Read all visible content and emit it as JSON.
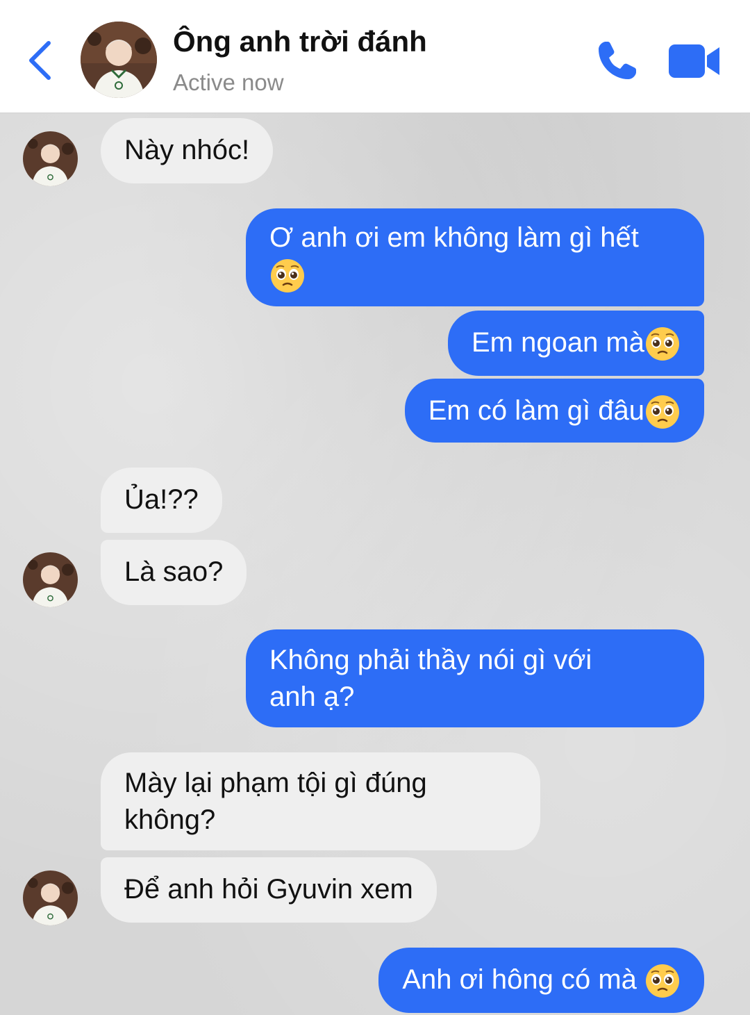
{
  "header": {
    "contact_name": "Ông anh trời đánh",
    "status": "Active now",
    "icons": {
      "back": "chevron-left-icon",
      "call": "phone-icon",
      "video": "video-camera-icon"
    },
    "accent_color": "#2d6df6"
  },
  "messages": [
    {
      "side": "in",
      "text": "Này nhóc!"
    },
    {
      "side": "out",
      "line1": "Ơ anh ơi em không làm gì hết",
      "emoji": "pleading-face-icon"
    },
    {
      "side": "out",
      "text": "Em ngoan mà",
      "emoji": "pleading-face-icon"
    },
    {
      "side": "out",
      "text": "Em có làm gì đâu",
      "emoji": "pleading-face-icon"
    },
    {
      "side": "in",
      "text": "Ủa!??"
    },
    {
      "side": "in",
      "text": "Là sao?"
    },
    {
      "side": "out",
      "line1": "Không phải thầy nói gì với",
      "line2": "anh ạ?"
    },
    {
      "side": "in",
      "line1": "Mày lại phạm tội gì đúng",
      "line2": "không?"
    },
    {
      "side": "in",
      "text": "Để anh hỏi Gyuvin xem"
    },
    {
      "side": "out",
      "text": "Anh ơi hông có mà ",
      "emoji": "pleading-face-icon"
    }
  ],
  "colors": {
    "incoming_bubble": "#efefef",
    "outgoing_bubble": "#2d6df6"
  }
}
